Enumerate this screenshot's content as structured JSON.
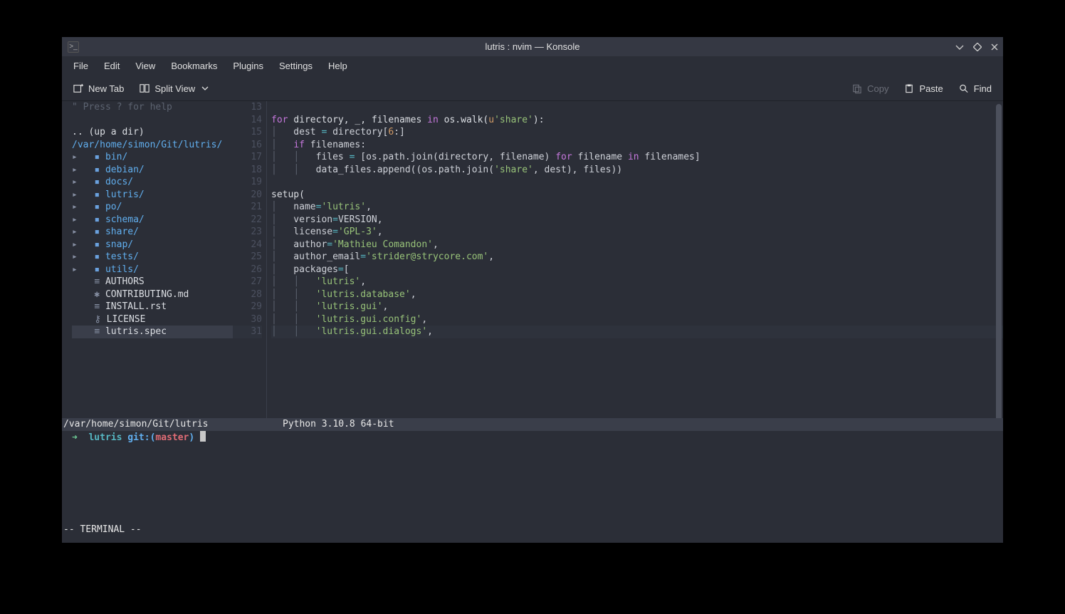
{
  "window": {
    "title": "lutris : nvim — Konsole",
    "menus": [
      "File",
      "Edit",
      "View",
      "Bookmarks",
      "Plugins",
      "Settings",
      "Help"
    ],
    "toolbar": {
      "newtab": "New Tab",
      "splitview": "Split View",
      "copy": "Copy",
      "paste": "Paste",
      "find": "Find"
    }
  },
  "nerdtree": {
    "help": "\" Press ? for help",
    "updir": ".. (up a dir)",
    "root": "/var/home/simon/Git/lutris/",
    "folders": [
      "bin/",
      "debian/",
      "docs/",
      "lutris/",
      "po/",
      "schema/",
      "share/",
      "snap/",
      "tests/",
      "utils/"
    ],
    "files": [
      {
        "icon": "≡",
        "name": "AUTHORS"
      },
      {
        "icon": "✱",
        "name": "CONTRIBUTING.md"
      },
      {
        "icon": "≡",
        "name": "INSTALL.rst"
      },
      {
        "icon": "⚷",
        "name": "LICENSE"
      },
      {
        "icon": "≡",
        "name": "lutris.spec"
      }
    ]
  },
  "editor": {
    "gutter_start": 13,
    "lines": [
      "",
      "<span class='c-purple'>for</span> <span class='c-white'>directory, _, filenames</span> <span class='c-purple'>in</span> <span class='c-white'>os.walk(</span><span class='c-orange'>u</span><span class='c-green'>'share'</span><span class='c-white'>):</span>",
      "    dest <span class='c-cyan'>=</span> directory[<span class='c-orange'>6</span>:]",
      "    <span class='c-purple'>if</span> filenames:",
      "        files <span class='c-cyan'>=</span> [os.path.join(directory, filename) <span class='c-purple'>for</span> filename <span class='c-purple'>in</span> filenames]",
      "        data_files.append((os.path.join(<span class='c-green'>'share'</span>, dest), files))",
      "",
      "<span class='c-white'>setup(</span>",
      "    name<span class='c-cyan'>=</span><span class='c-green'>'lutris'</span>,",
      "    version<span class='c-cyan'>=</span>VERSION,",
      "    license<span class='c-cyan'>=</span><span class='c-green'>'GPL-3'</span>,",
      "    author<span class='c-cyan'>=</span><span class='c-green'>'Mathieu Comandon'</span>,",
      "    author_email<span class='c-cyan'>=</span><span class='c-green'>'strider@strycore.com'</span>,",
      "    packages<span class='c-cyan'>=</span>[",
      "        <span class='c-green'>'lutris'</span>,",
      "        <span class='c-green'>'lutris.database'</span>,",
      "        <span class='c-green'>'lutris.gui'</span>,",
      "        <span class='c-green'>'lutris.gui.config'</span>,",
      "        <span class='c-green'>'lutris.gui.dialogs'</span>,"
    ]
  },
  "statusline": {
    "left": "/var/home/simon/Git/lutris",
    "right": "Python 3.10.8 64-bit"
  },
  "shell": {
    "arrow": "➜",
    "dir": "lutris",
    "git_lbl": "git:(",
    "branch": "master",
    "close": ")"
  },
  "mode": "-- TERMINAL --"
}
